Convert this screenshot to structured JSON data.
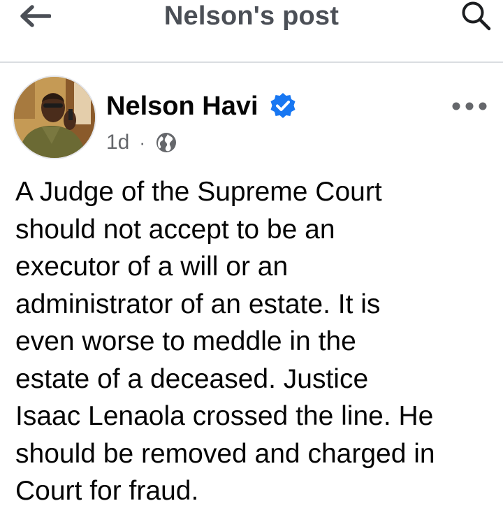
{
  "header": {
    "title": "Nelson's post",
    "back_icon": "arrow-left-icon",
    "search_icon": "search-icon"
  },
  "post": {
    "author": "Nelson Havi",
    "verified": true,
    "time": "1d",
    "separator": "·",
    "audience_icon": "globe-icon",
    "more_icon": "more-dots-icon",
    "text": "A Judge of the Supreme Court\nshould not accept to be an\nexecutor of a will or an\nadministrator of an estate. It is\neven worse to meddle in the\nestate of a deceased. Justice\nIsaac Lenaola crossed the line. He\nshould be removed and charged in\nCourt for fraud."
  },
  "colors": {
    "verified_blue": "#1877f2",
    "secondary_text": "#65676b",
    "divider": "#dadde1"
  }
}
